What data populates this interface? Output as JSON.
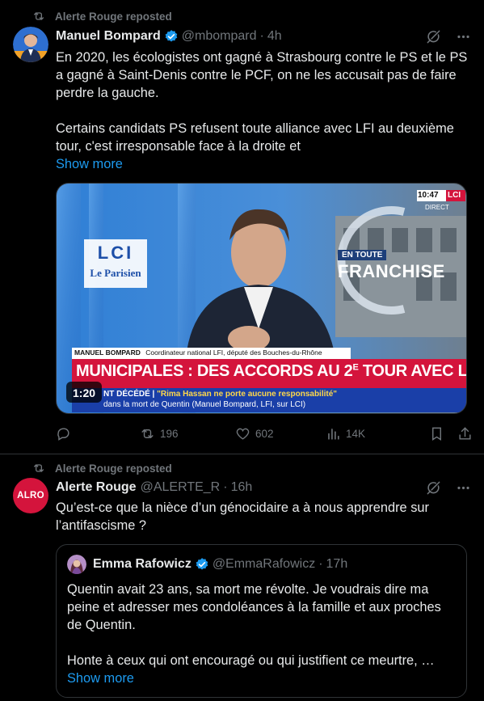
{
  "tweet1": {
    "repost_label": "Alerte Rouge reposted",
    "author_name": "Manuel Bompard",
    "author_handle": "@mbompard",
    "separator": "·",
    "time": "4h",
    "text_p1": "En 2020, les écologistes ont gagné à Strasbourg contre le PS et le PS a gagné à Saint-Denis contre le PCF, on ne les accusait pas de faire perdre la gauche.",
    "text_p2": "Certains candidats PS refusent toute alliance avec LFI au deuxième tour, c'est irresponsable face à la droite et",
    "show_more": "Show more",
    "video": {
      "clock": "10:47",
      "channel": "LCI",
      "live": "DIRECT",
      "logo_top": "LCI",
      "logo_bottom": "Le Parisien",
      "show_top": "EN TOUTE",
      "show_bottom": "FRANCHISE",
      "lower_name": "MANUEL BOMPARD",
      "lower_role": "Coordinateur national LFI, député des Bouches-du-Rhône",
      "headline": "MUNICIPALES : DES ACCORDS AU 2",
      "headline_sup": "E",
      "headline_end": " TOUR AVEC LE PS ?",
      "ticker_prefix": "NT DÉCÉDÉ |",
      "ticker_line1": "\"Rima Hassan ne porte aucune responsabilité\"",
      "ticker_line2": "dans la mort de Quentin (Manuel Bompard, LFI, sur LCI)",
      "duration": "1:20"
    },
    "stats": {
      "retweets": "196",
      "likes": "602",
      "views": "14K"
    }
  },
  "tweet2": {
    "repost_label": "Alerte Rouge reposted",
    "avatar_text": "ALRO",
    "author_name": "Alerte Rouge",
    "author_handle": "@ALERTE_R",
    "separator": "·",
    "time": "16h",
    "text": "Qu’est-ce que la nièce d’un génocidaire a à nous apprendre sur l’antifascisme ?",
    "quote": {
      "author_name": "Emma Rafowicz",
      "author_handle": "@EmmaRafowicz",
      "separator": "·",
      "time": "17h",
      "text_p1": "Quentin avait 23 ans, sa mort me révolte. Je voudrais dire ma peine et adresser mes condoléances à la famille et aux proches de Quentin.",
      "text_p2": "Honte à ceux qui ont encouragé ou qui justifient ce meurtre, …",
      "show_more": "Show more"
    }
  },
  "colors": {
    "accent": "#1d9bf0",
    "muted": "#71767b",
    "border": "#2f3336",
    "lci_red": "#d4143c"
  }
}
